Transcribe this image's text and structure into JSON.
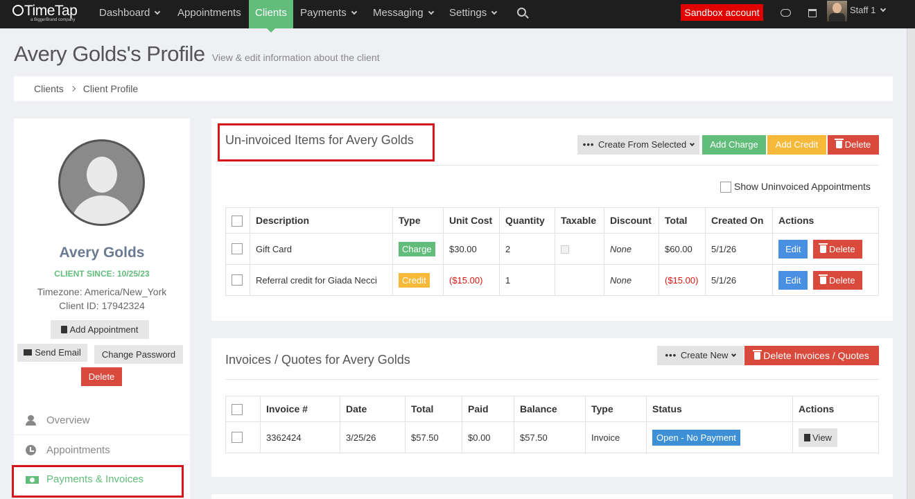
{
  "nav": {
    "logo": "TimeTap",
    "logo_sub": "a BiggerBrand company",
    "items": [
      {
        "label": "Dashboard"
      },
      {
        "label": "Appointments"
      },
      {
        "label": "Clients"
      },
      {
        "label": "Payments"
      },
      {
        "label": "Messaging"
      },
      {
        "label": "Settings"
      }
    ],
    "sandbox": "Sandbox account",
    "staff": "Staff 1"
  },
  "header": {
    "title": "Avery Golds's Profile",
    "subtitle": "View & edit information about the client"
  },
  "breadcrumb": {
    "items": [
      "Clients",
      "Client Profile"
    ]
  },
  "client": {
    "name": "Avery Golds",
    "since": "CLIENT SINCE: 10/25/23",
    "timezone": "Timezone: America/New_York",
    "client_id": "Client ID: 17942324",
    "add_appointment": "Add Appointment",
    "send_email": "Send Email",
    "change_password": "Change Password",
    "delete": "Delete"
  },
  "side_nav": [
    {
      "label": "Overview",
      "icon": "person-icon"
    },
    {
      "label": "Appointments",
      "icon": "clock-icon"
    },
    {
      "label": "Payments & Invoices",
      "icon": "money-icon",
      "active": true
    }
  ],
  "uninvoiced": {
    "title": "Un-invoiced Items for Avery Golds",
    "create_from_selected": "Create From Selected",
    "add_charge": "Add Charge",
    "add_credit": "Add Credit",
    "delete": "Delete",
    "show_label": "Show Uninvoiced Appointments",
    "columns": [
      "Description",
      "Type",
      "Unit Cost",
      "Quantity",
      "Taxable",
      "Discount",
      "Total",
      "Created On",
      "Actions"
    ],
    "rows": [
      {
        "description": "Gift Card",
        "type": "Charge",
        "unit_cost": "$30.00",
        "quantity": "2",
        "discount": "None",
        "total": "$60.00",
        "created_on": "5/1/26",
        "edit": "Edit",
        "delete": "Delete"
      },
      {
        "description": "Referral credit for Giada Necci",
        "type": "Credit",
        "unit_cost": "($15.00)",
        "quantity": "1",
        "discount": "None",
        "total": "($15.00)",
        "created_on": "5/1/26",
        "edit": "Edit",
        "delete": "Delete"
      }
    ]
  },
  "invoices": {
    "title": "Invoices / Quotes for Avery Golds",
    "create_new": "Create New",
    "delete": "Delete Invoices / Quotes",
    "columns": [
      "Invoice #",
      "Date",
      "Total",
      "Paid",
      "Balance",
      "Type",
      "Status",
      "Actions"
    ],
    "rows": [
      {
        "invoice": "3362424",
        "date": "3/25/26",
        "total": "$57.50",
        "paid": "$0.00",
        "balance": "$57.50",
        "type": "Invoice",
        "status": "Open - No Payment",
        "view": "View"
      }
    ]
  },
  "colors": {
    "accent_green": "#62bd7a",
    "danger_red": "#d9493c",
    "warning_yellow": "#f7b93a",
    "info_blue": "#4a90e2",
    "highlight": "#d6141a"
  }
}
